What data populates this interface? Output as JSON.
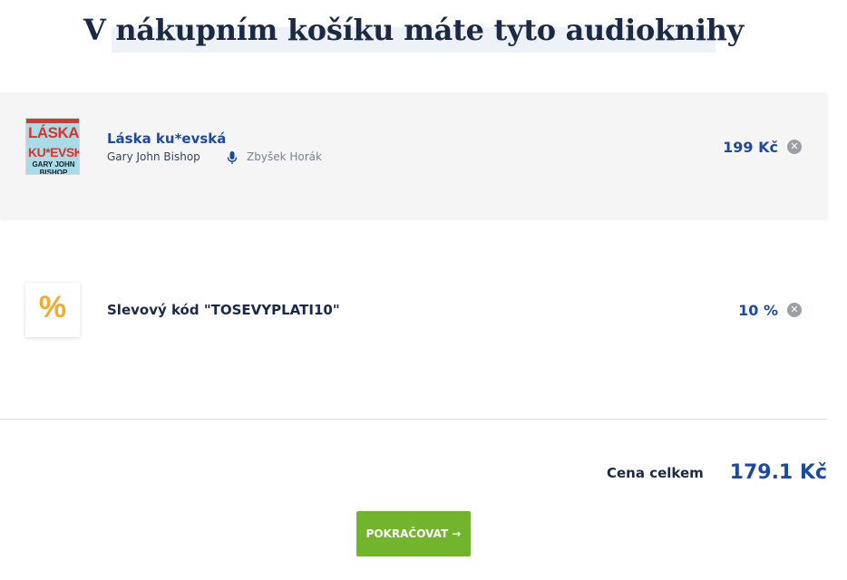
{
  "page": {
    "heading": "V nákupním košíku máte tyto audioknihy"
  },
  "cart": {
    "items": [
      {
        "cover_lines": [
          "LÁSKA",
          "KU*EVSKÁ",
          "GARY JOHN BISHOP"
        ],
        "title": "Láska ku*evská",
        "author": "Gary John Bishop",
        "narrator": "Zbyšek Horák",
        "narrator_icon": "microphone-icon",
        "price": "199 Kč",
        "remove_icon": "close-circle-icon"
      }
    ],
    "discount": {
      "icon_glyph": "%",
      "label": "Slevový kód \"TOSEVYPLATI10\"",
      "value": "10 %",
      "remove_icon": "close-circle-icon"
    }
  },
  "summary": {
    "total_label": "Cena celkem",
    "total_value": "179.1 Kč"
  },
  "actions": {
    "continue_label": "POKRAČOVAT →"
  },
  "colors": {
    "accent_blue": "#1d4aa1",
    "button_green": "#70b52c",
    "percent_orange": "#f2ab2c",
    "heading_dark": "#1a2a45"
  }
}
